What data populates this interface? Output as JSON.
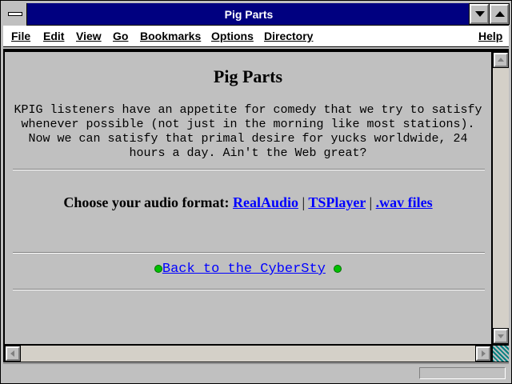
{
  "window": {
    "title": "Pig Parts"
  },
  "menu": {
    "file": "File",
    "edit": "Edit",
    "view": "View",
    "go": "Go",
    "bookmarks": "Bookmarks",
    "options": "Options",
    "directory": "Directory",
    "help": "Help"
  },
  "page": {
    "heading": "Pig Parts",
    "intro": "KPIG listeners have an appetite for comedy that we try to satisfy whenever possible (not just in the morning like most stations). Now we can satisfy that primal desire for yucks worldwide, 24 hours a day. Ain't the Web great?",
    "format_label": "Choose your audio format:",
    "formats": [
      "RealAudio",
      "TSPlayer",
      ".wav files"
    ],
    "separator": "|",
    "back_link": "Back to the CyberSty"
  },
  "colors": {
    "titlebar": "#000080",
    "link": "#0000ff",
    "bullet": "#00c000"
  }
}
